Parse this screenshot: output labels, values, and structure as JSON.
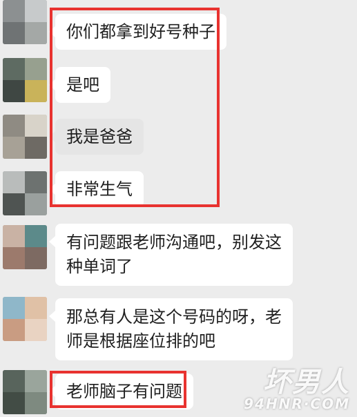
{
  "messages": [
    {
      "text": "你们都拿到好号种子"
    },
    {
      "text": "是吧"
    },
    {
      "text": "我是爸爸"
    },
    {
      "text": "非常生气"
    },
    {
      "text": "有问题跟老师沟通吧，别发这种单词了"
    },
    {
      "text": "那总有人是这个号码的呀，老师是根据座位排的吧"
    },
    {
      "text": "老师脑子有问题"
    }
  ],
  "watermark": {
    "name": "坏男人",
    "url": "94HNR·COM"
  },
  "colors": {
    "background": "#ececec",
    "bubble": "#ffffff",
    "bubble_pressed": "#e5e5e5",
    "highlight_box": "#e8322f",
    "text": "#1f1f1f"
  }
}
